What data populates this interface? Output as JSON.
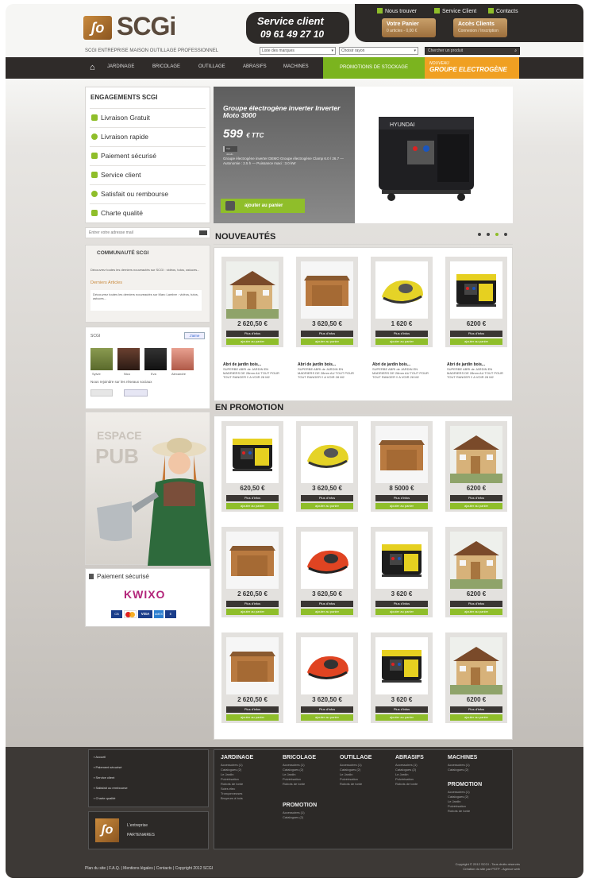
{
  "header": {
    "logo_text": "SCGi",
    "logo_mark": "ʃo",
    "service_title": "Service client",
    "service_phone": "09 61 49 27 10",
    "top_links": [
      "Nous trouver",
      "Service Client",
      "Contacts"
    ],
    "btn_register": "Votre Panier",
    "btn_register_sub": "0 articles - 0,00 €",
    "btn_account": "Accès Clients",
    "btn_account_sub": "Connexion / Inscription",
    "tagline": "SCGI ENTREPRISE  MAISON OUTILLAGE PROFESSIONNEL",
    "select_1": "Liste des marques",
    "select_2": "Choisir rayon",
    "search_placeholder": "Chercher un produit"
  },
  "nav": {
    "items": [
      "JARDINAGE",
      "BRICOLAGE",
      "OUTILLAGE",
      "ABRASIFS",
      "MACHINES"
    ],
    "promo": "PROMOTIONS DE STOCKAGE",
    "group_small": "NOUVEAU",
    "group_big": "GROUPE ELECTROGÈNE"
  },
  "sidebar": {
    "engage_title": "ENGAGEMENTS SCGI",
    "engagements": [
      "Livraison Gratuit",
      "Livraison rapide",
      "Paiement sécurisé",
      "Service client",
      "Satisfait ou rembourse",
      "Charte qualité"
    ],
    "newsletter_placeholder": "Entrer votre adresse mail",
    "community_title": "COMMUNAUTÉ SCGI",
    "community_text": "Découvrez toutes les derniers nouveautés sur SCGI : vidéos, tutos, astuces...",
    "community_link": "Derniers Articles",
    "community_text2": "Découvrez toutes les derniers nouveautés sur Marc Lambre : vidéos, tutos, astuces...",
    "fb_title": "SCGI",
    "fb_like": "J'aime",
    "fb_names": [
      "Sylvie",
      "Nico",
      "Eva",
      "Alexandre"
    ],
    "fb_follow": "Nous rejoindre sur les réseaux sociaux",
    "pub_line1": "ESPACE",
    "pub_line2": "PUB",
    "pay_title": "Paiement sécurisé",
    "pay_brand": "KWIXO",
    "pay_cards": [
      "CB",
      "MC",
      "VISA",
      "AMEX",
      "E"
    ]
  },
  "hero": {
    "title": "Groupe électrogène inverter Inverter Moto 3000",
    "price": "599",
    "price_unit": "€ TTC",
    "tag": "Voir détails",
    "desc": "Groupe électrogène inverter DEMO Groupe électrogène Clamp 6.0 / 26.7 — Autonomie : 2.5 h — Puissance maxi : 3.0 kW",
    "cta": "ajouter au panier",
    "brand": "HYUNDAI"
  },
  "sections": {
    "new_title": "NOUVEAUTÉS",
    "promo_title": "EN PROMOTION"
  },
  "new_products": [
    {
      "img": "shed-icon",
      "price": "2 620,50 €",
      "name": "Abri de jardin bois...",
      "desc": "SUPERBE ABRI de JARDIN EN MADRIERS DE 28mm AU TOUT POUR TOUT RANGER !! A VOIR 28 M2"
    },
    {
      "img": "garage-icon",
      "price": "3 620,50 €",
      "name": "Abri de jardin bois...",
      "desc": "SUPERBE ABRI de JARDIN EN MADRIERS DE 28mm AU TOUT POUR TOUT RANGER !! A VOIR 28 M2"
    },
    {
      "img": "robot-mower-yellow-icon",
      "price": "1 620 €",
      "name": "Abri de jardin bois...",
      "desc": "SUPERBE ABRI de JARDIN EN MADRIERS DE 28mm AU TOUT POUR TOUT RANGER !! A VOIR 28 M2"
    },
    {
      "img": "generator-icon",
      "price": "6200 €",
      "name": "Abri de jardin bois...",
      "desc": "SUPERBE ABRI de JARDIN EN MADRIERS DE 28mm AU TOUT POUR TOUT RANGER !! A VOIR 28 M2"
    }
  ],
  "promo_products": [
    {
      "img": "generator-icon",
      "price": "620,50 €"
    },
    {
      "img": "robot-mower-yellow-icon",
      "price": "3 620,50 €"
    },
    {
      "img": "garage-icon",
      "price": "8 5000 €"
    },
    {
      "img": "shed-icon",
      "price": "6200 €"
    },
    {
      "img": "garage-icon",
      "price": "2 620,50 €"
    },
    {
      "img": "robot-mower-red-icon",
      "price": "3 620,50 €"
    },
    {
      "img": "generator-icon",
      "price": "3 620 €"
    },
    {
      "img": "shed-icon",
      "price": "6200 €"
    },
    {
      "img": "garage-icon",
      "price": "2 620,50 €"
    },
    {
      "img": "robot-mower-red-icon",
      "price": "3 620,50 €"
    },
    {
      "img": "generator-icon",
      "price": "3 620 €"
    },
    {
      "img": "shed-icon",
      "price": "6200 €"
    }
  ],
  "card_buttons": {
    "details": "Plus d'infos",
    "cart": "ajouter au panier"
  },
  "footer": {
    "left_links": [
      "Accueil",
      "Paiement sécurisé",
      "Service client",
      "Satisfait ou rembourse",
      "Charte qualité"
    ],
    "box_line1": "L'entreprise",
    "box_line2": "PARTENAIRES",
    "cols": [
      {
        "title": "JARDINAGE",
        "items": "Accessoires (1)\nCatalogues (2)\nLe Jardin\nPulvérisation\nRobots de tonte\nScies élec\nTronçonneuses\nBroyeurs à bois"
      },
      {
        "title": "BRICOLAGE",
        "items": "Accessoires (1)\nCatalogues (2)\nLe Jardin\nPulvérisation\nRobots de tonte"
      },
      {
        "title": "OUTILLAGE",
        "items": "Accessoires (1)\nCatalogues (2)\nLe Jardin\nPulvérisation\nRobots de tonte"
      },
      {
        "title": "ABRASIFS",
        "items": "Accessoires (1)\nCatalogues (2)\nLe Jardin\nPulvérisation\nRobots de tonte"
      },
      {
        "title": "MACHINES",
        "items": "Accessoires (1)\nCatalogues (2)"
      }
    ],
    "col2_sub_title": "PROMOTION",
    "col2_sub_items": "Accessoires (1)\nCatalogues (2)",
    "col5_sub_title": "PROMOTION",
    "col5_sub_items": "Accessoires (1)\nCatalogues (2)\nLe Jardin\nPulvérisation\nRobots de tonte",
    "bottom_links": "Plan du site   |   F.A.Q.   |   Mentions légales   |   Contacts   |   Copyright 2012 SCGI",
    "copyright": "Copyright © 2012 SCGI - Tous droits réservés\nCréation du site par PSTP - Agence web"
  }
}
